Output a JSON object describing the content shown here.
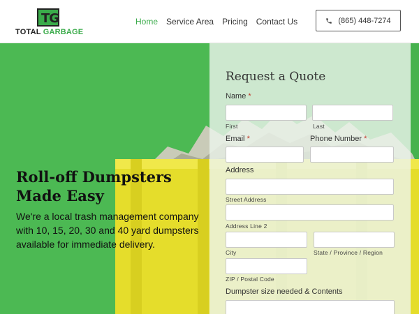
{
  "brand": {
    "logo_letters": "TG",
    "name_part1": "TOTAL",
    "name_part2": "GARBAGE",
    "accent": "#3aab4a"
  },
  "nav": {
    "items": [
      {
        "label": "Home",
        "active": true
      },
      {
        "label": "Service Area",
        "active": false
      },
      {
        "label": "Pricing",
        "active": false
      },
      {
        "label": "Contact Us",
        "active": false
      }
    ]
  },
  "phone": {
    "icon": "phone-icon",
    "label": "(865) 448-7274"
  },
  "hero": {
    "title": "Roll-off Dumpsters Made Easy",
    "subtitle": "We're a local trash management company with 10, 15, 20, 30 and 40 yard dumpsters available for immediate delivery."
  },
  "quote": {
    "heading": "Request a Quote",
    "name_label": "Name",
    "first_label": "First",
    "last_label": "Last",
    "email_label": "Email",
    "phone_label": "Phone Number",
    "address_label": "Address",
    "street_label": "Street Address",
    "line2_label": "Address Line 2",
    "city_label": "City",
    "state_label": "State / Province / Region",
    "zip_label": "ZIP / Postal Code",
    "dumpster_label": "Dumpster size needed & Contents",
    "required_mark": "*"
  }
}
